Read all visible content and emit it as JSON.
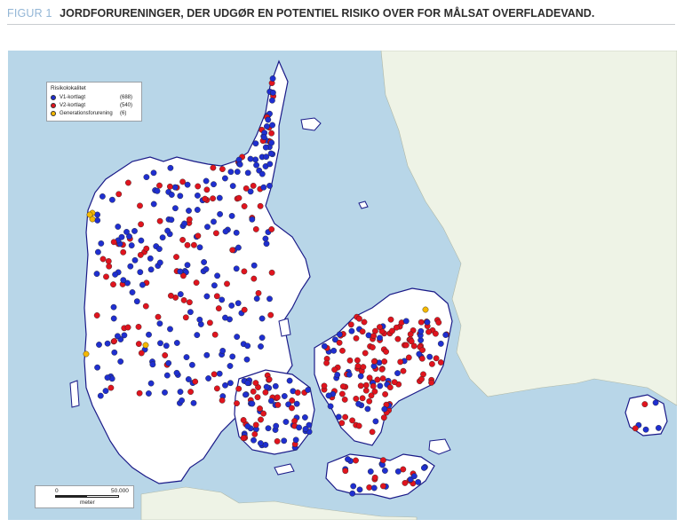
{
  "header": {
    "figure_number": "FIGUR 1",
    "title": "JORDFORURENINGER, DER UDGØR EN POTENTIEL RISIKO OVER FOR MÅLSAT OVERFLADEVAND."
  },
  "legend": {
    "title": "Risikolokalitet",
    "items": [
      {
        "label": "V1-kortlagt",
        "count": "(688)",
        "color": "#1f2fd0"
      },
      {
        "label": "V2-kortlagt",
        "count": "(540)",
        "color": "#e0141e"
      },
      {
        "label": "Generationsforurening",
        "count": "(6)",
        "color": "#f5b800"
      }
    ]
  },
  "scale_bar": {
    "start_label": "0",
    "end_label": "50.000",
    "unit": "meter"
  },
  "colors": {
    "sea": "#b8d6e8",
    "land": "#ffffff",
    "sweden_land": "#eef3e6",
    "outline": "#1a1a88",
    "v1": "#1f2fd0",
    "v2": "#e0141e",
    "generation": "#f5b800"
  }
}
